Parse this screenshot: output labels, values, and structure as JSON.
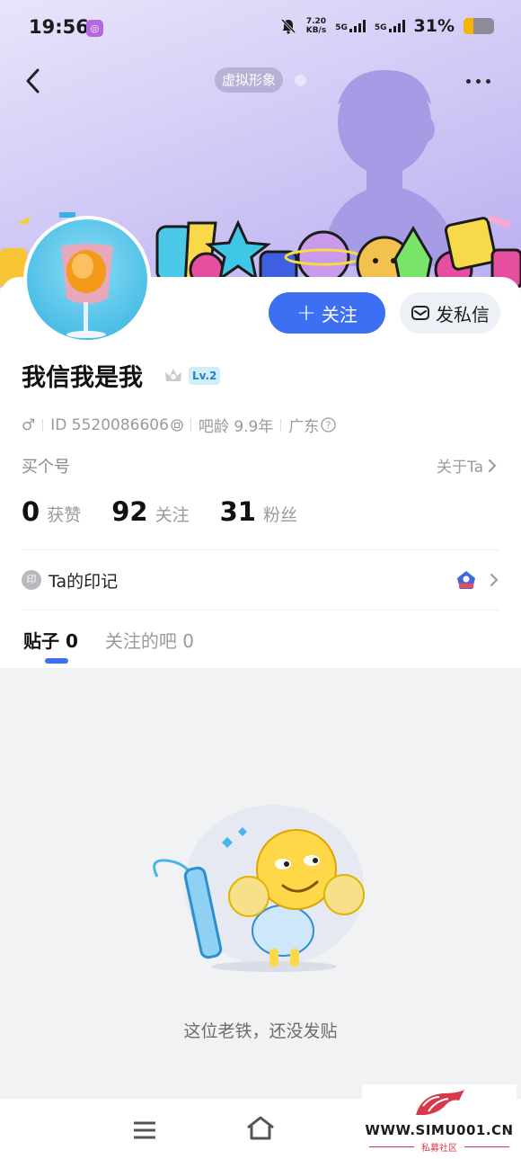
{
  "status_bar": {
    "time": "19:56",
    "network_speed_value": "7.20",
    "network_speed_unit": "KB/s",
    "signal_1": "5G",
    "signal_2": "5G",
    "battery_percent": "31%",
    "battery_level": 0.31
  },
  "header": {
    "virtual_avatar_label": "虚拟形象"
  },
  "profile": {
    "name": "我信我是我",
    "level": "Lv.2",
    "id_text": "ID 5520086606",
    "bar_age": "吧龄 9.9年",
    "location": "广东",
    "sub_label": "买个号",
    "about_label": "关于Ta"
  },
  "actions": {
    "follow_label": "关注",
    "follow_symbol": "+",
    "message_label": "发私信"
  },
  "stats": [
    {
      "value": "0",
      "label": "获赞"
    },
    {
      "value": "92",
      "label": "关注"
    },
    {
      "value": "31",
      "label": "粉丝"
    }
  ],
  "mark": {
    "icon_text": "印",
    "label": "Ta的印记"
  },
  "tabs": [
    {
      "label": "贴子",
      "count": "0",
      "active": true
    },
    {
      "label": "关注的吧",
      "count": "0",
      "active": false
    }
  ],
  "empty_state": {
    "message": "这位老铁，还没发贴"
  },
  "watermark": {
    "url": "WWW.SIMU001.CN",
    "subtitle": "私募社区"
  },
  "colors": {
    "accent": "#3d6ff2",
    "banner_top": "#e9e4fb",
    "banner_bottom": "#b9aef0"
  },
  "icons": [
    "back-icon",
    "more-icon",
    "male-icon",
    "copy-icon",
    "help-icon",
    "chevron-right-icon",
    "mail-icon",
    "crown-icon",
    "mark-badge-icon",
    "menu-icon",
    "home-icon"
  ]
}
